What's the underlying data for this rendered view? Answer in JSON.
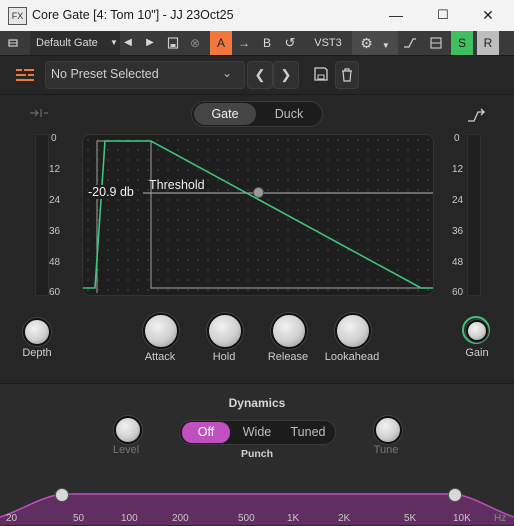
{
  "window": {
    "fx_badge": "FX",
    "title": "Core Gate [4: Tom 10\"] - JJ 23Oct25",
    "minimize": "—",
    "maximize": "☐",
    "close": "✕"
  },
  "toolbar": {
    "preset_menu": "Default Gate",
    "ab_a": "A",
    "ab_b": "B",
    "format": "VST3",
    "solo": "S",
    "record": "R",
    "colors": {
      "a_active": "#f0783c",
      "solo_active": "#3fbf5f"
    }
  },
  "preset_bar": {
    "preset_name": "No Preset Selected"
  },
  "mode": {
    "options": [
      "Gate",
      "Duck"
    ],
    "selected": "Gate"
  },
  "meter_scale": [
    "0",
    "12",
    "24",
    "36",
    "48",
    "60"
  ],
  "graph": {
    "threshold_value": "-20.9 db",
    "threshold_label": "Threshold",
    "curve_color": "#3fc47a"
  },
  "knobs": {
    "depth": "Depth",
    "attack": "Attack",
    "hold": "Hold",
    "release": "Release",
    "lookahead": "Lookahead",
    "gain": "Gain"
  },
  "dynamics": {
    "title": "Dynamics",
    "level": "Level",
    "tune": "Tune",
    "punch_label": "Punch",
    "punch_options": [
      "Off",
      "Wide",
      "Tuned"
    ],
    "punch_selected": "Off",
    "accent": "#c04fc0"
  },
  "freq_axis": {
    "ticks": [
      "20",
      "50",
      "100",
      "200",
      "500",
      "1K",
      "2K",
      "5K",
      "10K"
    ],
    "unit": "Hz"
  }
}
